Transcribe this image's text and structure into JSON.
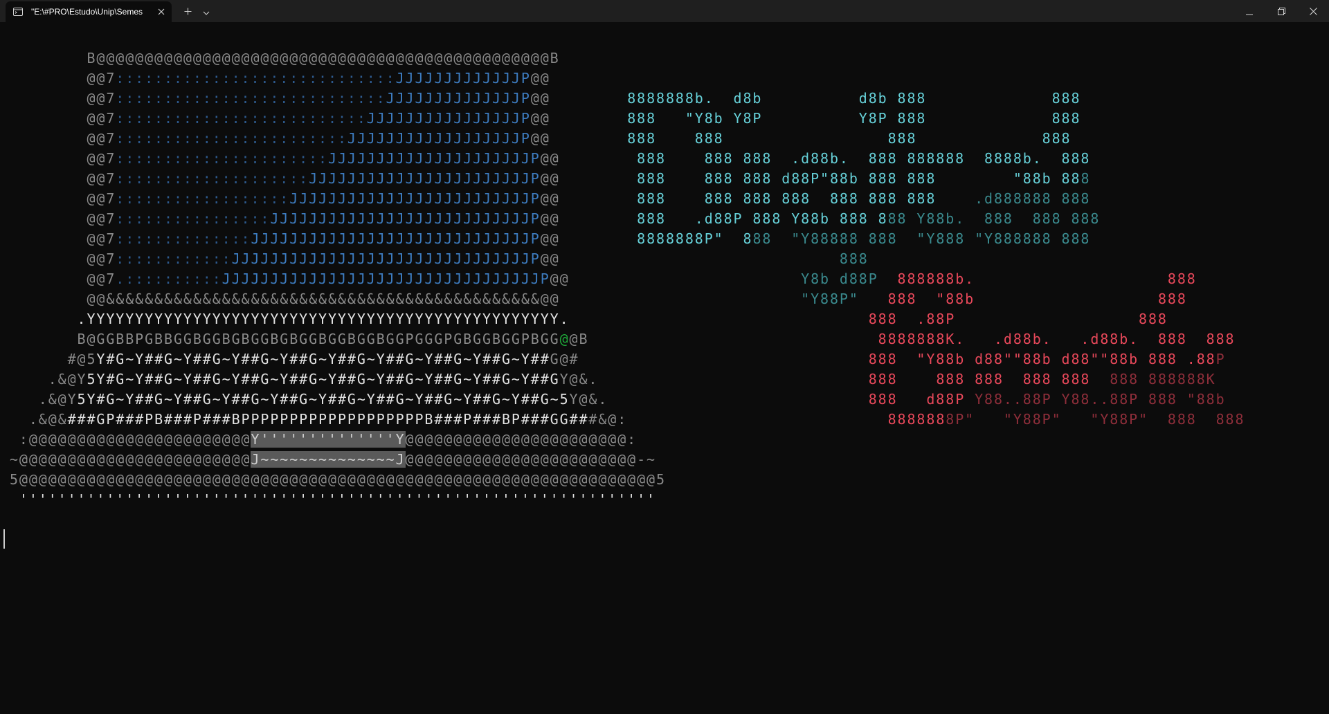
{
  "window": {
    "tab_title": "\"E:\\#PRO\\Estudo\\Unip\\Semes",
    "tab_icon": "terminal-icon",
    "close_tab_icon": "close-icon",
    "new_tab_icon": "plus-icon",
    "dropdown_icon": "chevron-down-icon",
    "minimize_icon": "minimize-icon",
    "maximize_icon": "restore-icon",
    "close_icon": "close-icon"
  },
  "colors": {
    "background": "#0c0c0c",
    "art_gray": "#8a8a8a",
    "art_blue": "#3d7cc0",
    "logo_cyan": "#66d0d8",
    "logo_red": "#e8485a"
  },
  "terminal": {
    "lines": [
      [
        [
          "g",
          "         B@@@@@@@@@@@@@@@@@@@@@@@@@@@@@@@@@@@@@@@@@@@@@@@B"
        ]
      ],
      [
        [
          "g",
          "         @@7"
        ],
        [
          "bd",
          ":::::::::::::::::::::::::::::"
        ],
        [
          "b",
          "JJJJJJJJJJJJJP"
        ],
        [
          "g",
          "@@"
        ]
      ],
      [
        [
          "g",
          "         @@7"
        ],
        [
          "bd",
          "::::::::::::::::::::::::::::"
        ],
        [
          "b",
          "JJJJJJJJJJJJJJP"
        ],
        [
          "g",
          "@@"
        ],
        [
          "w",
          "        "
        ],
        [
          "c",
          "8888888b.  d8b          d8b 888             888"
        ]
      ],
      [
        [
          "g",
          "         @@7"
        ],
        [
          "bd",
          "::::::::::::::::::::::::::"
        ],
        [
          "b",
          "JJJJJJJJJJJJJJJJP"
        ],
        [
          "g",
          "@@"
        ],
        [
          "w",
          "        "
        ],
        [
          "c",
          "888   \"Y8b Y8P          Y8P 888             888"
        ]
      ],
      [
        [
          "g",
          "         @@7"
        ],
        [
          "bd",
          "::::::::::::::::::::::::"
        ],
        [
          "b",
          "JJJJJJJJJJJJJJJJJJP"
        ],
        [
          "g",
          "@@"
        ],
        [
          "w",
          "        "
        ],
        [
          "c",
          "888    888                 888             888"
        ]
      ],
      [
        [
          "g",
          "         @@7"
        ],
        [
          "bd",
          "::::::::::::::::::::::"
        ],
        [
          "b",
          "JJJJJJJJJJJJJJJJJJJJJP"
        ],
        [
          "g",
          "@@"
        ],
        [
          "w",
          "        "
        ],
        [
          "c",
          "888    888 888  .d88b.  888 888888  8888b.  888"
        ]
      ],
      [
        [
          "g",
          "         @@7"
        ],
        [
          "bd",
          "::::::::::::::::::::"
        ],
        [
          "b",
          "JJJJJJJJJJJJJJJJJJJJJJJP"
        ],
        [
          "g",
          "@@"
        ],
        [
          "w",
          "        "
        ],
        [
          "c",
          "888    888 888 d88P\"88b 888 888        \"88b 88"
        ],
        [
          "cd",
          "8"
        ]
      ],
      [
        [
          "g",
          "         @@7"
        ],
        [
          "bd",
          "::::::::::::::::::"
        ],
        [
          "b",
          "JJJJJJJJJJJJJJJJJJJJJJJJJP"
        ],
        [
          "g",
          "@@"
        ],
        [
          "w",
          "        "
        ],
        [
          "c",
          "888    888 888 888  888 888 888    "
        ],
        [
          "cd",
          ".d888888 888"
        ]
      ],
      [
        [
          "g",
          "         @@7"
        ],
        [
          "bd",
          "::::::::::::::::"
        ],
        [
          "b",
          "JJJJJJJJJJJJJJJJJJJJJJJJJJJP"
        ],
        [
          "g",
          "@@"
        ],
        [
          "w",
          "        "
        ],
        [
          "c",
          "888   .d88P 888 Y88b 888 8"
        ],
        [
          "cd",
          "88 Y88b.  888  888 888"
        ]
      ],
      [
        [
          "g",
          "         @@7"
        ],
        [
          "bd",
          "::::::::::::::"
        ],
        [
          "b",
          "JJJJJJJJJJJJJJJJJJJJJJJJJJJJJP"
        ],
        [
          "g",
          "@@"
        ],
        [
          "w",
          "        "
        ],
        [
          "c",
          "8888888P\"  8"
        ],
        [
          "cd",
          "88  \"Y88888 888  \"Y888 \"Y888888 888"
        ]
      ],
      [
        [
          "g",
          "         @@7"
        ],
        [
          "bd",
          "::::::::::::"
        ],
        [
          "b",
          "JJJJJJJJJJJJJJJJJJJJJJJJJJJJJJJP"
        ],
        [
          "g",
          "@@"
        ],
        [
          "w",
          "        "
        ],
        [
          "cd",
          "                     888"
        ]
      ],
      [
        [
          "g",
          "         @@7"
        ],
        [
          "bd",
          ".::::::::::"
        ],
        [
          "b",
          "JJJJJJJJJJJJJJJJJJJJJJJJJJJJJJJJJP"
        ],
        [
          "g",
          "@@"
        ],
        [
          "w",
          "        "
        ],
        [
          "cd",
          "                Y8b d88P  "
        ],
        [
          "r",
          "888888b.                    888"
        ]
      ],
      [
        [
          "g",
          "         @@&&&&&&&&&&&&&&&&&&&&&&&&&&&&&&&&&&&&&&&&&&&&&@@"
        ],
        [
          "w",
          "        "
        ],
        [
          "cd",
          "                 \"Y88P\"   "
        ],
        [
          "r",
          "888  \"88b                   888"
        ]
      ],
      [
        [
          "w",
          "        .YYYYYYYYYYYYYYYYYYYYYYYYYYYYYYYYYYYYYYYYYYYYYYYYY."
        ],
        [
          "w",
          "                               "
        ],
        [
          "r",
          "888  .88P                   888"
        ]
      ],
      [
        [
          "g",
          "        B@GGBBPGBBGGBGGBGBGGBGBGGBGGBGGBGGPGGGPGBGGBGGPBGG"
        ],
        [
          "gr",
          "@"
        ],
        [
          "g",
          "@B"
        ],
        [
          "w",
          "                              "
        ],
        [
          "r",
          "8888888K.   .d88b.   .d88b.  888  888"
        ]
      ],
      [
        [
          "g",
          "       #@5"
        ],
        [
          "w",
          "Y#G~Y##G~Y##G~Y##G~Y##G~Y##G~Y##G~Y##G~Y##G~Y##"
        ],
        [
          "g",
          "G@#"
        ],
        [
          "w",
          "                              "
        ],
        [
          "r",
          "888  \"Y88b d88\"\"88b d88\"\"88b 888 .88"
        ],
        [
          "rd",
          "P"
        ]
      ],
      [
        [
          "g",
          "     .&@Y"
        ],
        [
          "w",
          "5Y#G~Y##G~Y##G~Y##G~Y##G~Y##G~Y##G~Y##G~Y##G~Y##G"
        ],
        [
          "g",
          "Y@&."
        ],
        [
          "w",
          "                            "
        ],
        [
          "r",
          "888    888 888  888 888 "
        ],
        [
          "rd",
          " 888 888888K"
        ]
      ],
      [
        [
          "g",
          "    .&@Y"
        ],
        [
          "w",
          "5Y#G~Y##G~Y##G~Y##G~Y##G~Y##G~Y##G~Y##G~Y##G~Y##G~5"
        ],
        [
          "g",
          "Y@&."
        ],
        [
          "w",
          "                           "
        ],
        [
          "r",
          "888   d88P "
        ],
        [
          "rd",
          "Y88..88P Y88..88P 888 \"88b"
        ]
      ],
      [
        [
          "g",
          "   .&@&"
        ],
        [
          "w",
          "###GP###PB###P###BPPPPPPPPPPPPPPPPPPPB###P###BP###GG##"
        ],
        [
          "g",
          "#&@:"
        ],
        [
          "w",
          "                           "
        ],
        [
          "r",
          "888888"
        ],
        [
          "rd",
          "8P\"   \"Y88P\"   \"Y88P\"  888  888"
        ]
      ],
      [
        [
          "g",
          "  :@@@@@@@@@@@@@@@@@@@@@@@"
        ],
        [
          "hl",
          "Y''''''''''''''Y"
        ],
        [
          "g",
          "@@@@@@@@@@@@@@@@@@@@@@@:"
        ]
      ],
      [
        [
          "g",
          " ~@@@@@@@@@@@@@@@@@@@@@@@@"
        ],
        [
          "hl",
          "J~~~~~~~~~~~~~~J"
        ],
        [
          "g",
          "@@@@@@@@@@@@@@@@@@@@@@@@-~"
        ]
      ],
      [
        [
          "g",
          " 5@@@@@@@@@@@@@@@@@@@@@@@@@@@@@@@@@@@@@@@@@@@@@@@@@@@@@@@@@@@@@@@@@@5"
        ]
      ],
      [
        [
          "w",
          "  ''''''''''''''''''''''''''''''''''''''''''''''''''''''''''''''''''"
        ]
      ]
    ]
  }
}
